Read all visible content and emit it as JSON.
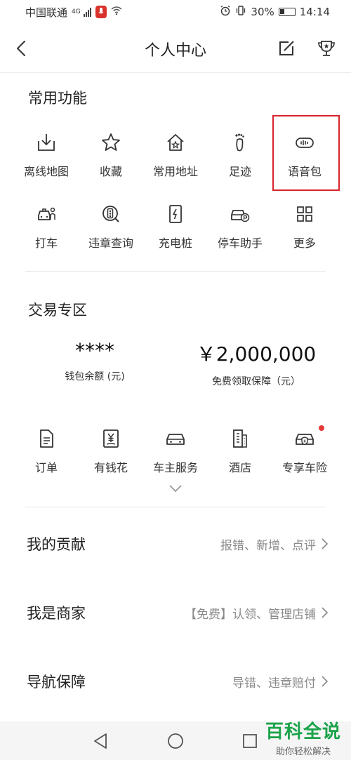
{
  "status_bar": {
    "carrier": "中国联通",
    "network": "4G",
    "battery": "30%",
    "time": "14:14"
  },
  "header": {
    "title": "个人中心",
    "icons": [
      "back-icon",
      "edit-icon",
      "trophy-icon"
    ]
  },
  "common_functions": {
    "title": "常用功能",
    "rows": [
      [
        {
          "label": "离线地图",
          "icon": "download-box-icon"
        },
        {
          "label": "收藏",
          "icon": "star-icon"
        },
        {
          "label": "常用地址",
          "icon": "house-star-icon"
        },
        {
          "label": "足迹",
          "icon": "footprint-icon"
        },
        {
          "label": "语音包",
          "icon": "voice-wave-icon"
        }
      ],
      [
        {
          "label": "打车",
          "icon": "taxi-icon"
        },
        {
          "label": "违章查询",
          "icon": "violation-icon"
        },
        {
          "label": "充电桩",
          "icon": "charging-icon"
        },
        {
          "label": "停车助手",
          "icon": "parking-car-icon"
        },
        {
          "label": "更多",
          "icon": "grid-icon"
        }
      ]
    ]
  },
  "trading": {
    "title": "交易专区",
    "wallet_value": "****",
    "wallet_label": "钱包余额 (元)",
    "insurance_value": "￥2,000,000",
    "insurance_label": "免费领取保障（元）",
    "items": [
      {
        "label": "订单",
        "icon": "document-icon"
      },
      {
        "label": "有钱花",
        "icon": "yuan-icon"
      },
      {
        "label": "车主服务",
        "icon": "car-icon"
      },
      {
        "label": "酒店",
        "icon": "hotel-icon"
      },
      {
        "label": "专享车险",
        "icon": "car-shield-icon",
        "has_badge": true
      }
    ]
  },
  "list": [
    {
      "title": "我的贡献",
      "detail": "报错、新增、点评"
    },
    {
      "title": "我是商家",
      "detail": "【免费】认领、管理店铺"
    },
    {
      "title": "导航保障",
      "detail": "导错、违章赔付"
    }
  ],
  "watermark": {
    "main": "百科全说",
    "sub": "助你轻松解决"
  },
  "colors": {
    "highlight": "#d8232a",
    "badge": "#e53935",
    "watermark": "#1aa34a"
  }
}
